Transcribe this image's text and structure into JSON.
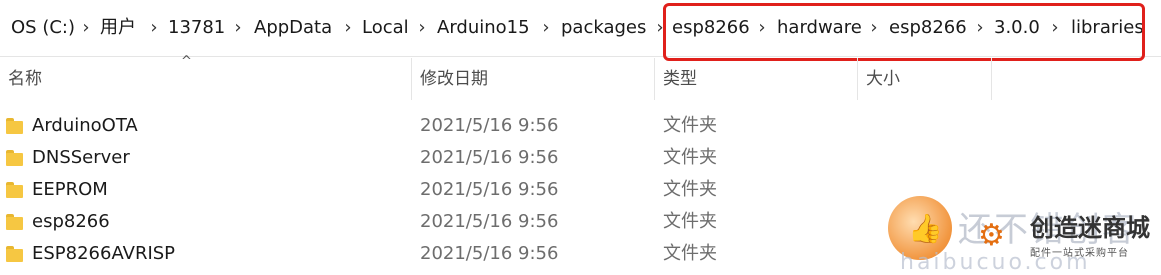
{
  "breadcrumb": {
    "segments": [
      "OS (C:)",
      "用户",
      "13781",
      "AppData",
      "Local",
      "Arduino15",
      "packages",
      "esp8266",
      "hardware",
      "esp8266",
      "3.0.0",
      "libraries"
    ],
    "separator": "›"
  },
  "columns": {
    "name": "名称",
    "date": "修改日期",
    "type": "类型",
    "size": "大小",
    "sort_indicator": "^"
  },
  "files": [
    {
      "name": "ArduinoOTA",
      "date": "2021/5/16 9:56",
      "type": "文件夹"
    },
    {
      "name": "DNSServer",
      "date": "2021/5/16 9:56",
      "type": "文件夹"
    },
    {
      "name": "EEPROM",
      "date": "2021/5/16 9:56",
      "type": "文件夹"
    },
    {
      "name": "esp8266",
      "date": "2021/5/16 9:56",
      "type": "文件夹"
    },
    {
      "name": "ESP8266AVRISP",
      "date": "2021/5/16 9:56",
      "type": "文件夹"
    }
  ],
  "watermark": {
    "big_text": "还不错创客",
    "brand": "创造迷商城",
    "subtitle": "配件一站式采购平台",
    "url": "haibucuo.com"
  },
  "colors": {
    "highlight_border": "#e0201b",
    "folder": "#f6c742",
    "muted_text": "#6d6d6d"
  }
}
